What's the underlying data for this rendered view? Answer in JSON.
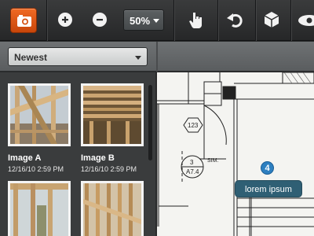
{
  "toolbar": {
    "zoom_value": "50%",
    "icons": [
      "camera-icon",
      "zoom-in-icon",
      "zoom-out-icon",
      "pointer-hand-icon",
      "undo-icon",
      "cube-icon",
      "eye-icon"
    ]
  },
  "filter": {
    "selected": "Newest"
  },
  "photos": [
    {
      "title": "Image A",
      "date": "12/16/10 2:59 PM"
    },
    {
      "title": "Image B",
      "date": "12/16/10 2:59 PM"
    },
    {
      "title": "",
      "date": ""
    },
    {
      "title": "",
      "date": ""
    }
  ],
  "drawing": {
    "tags": {
      "hex": "123",
      "circle_top": "3",
      "circle_bottom": "A7.4",
      "sim": "SIM."
    }
  },
  "marker": {
    "number": "4",
    "tooltip": "lorem ipsum"
  },
  "colors": {
    "accent": "#e25a17",
    "marker": "#2d7fc0",
    "tooltip": "#2f5f74"
  }
}
